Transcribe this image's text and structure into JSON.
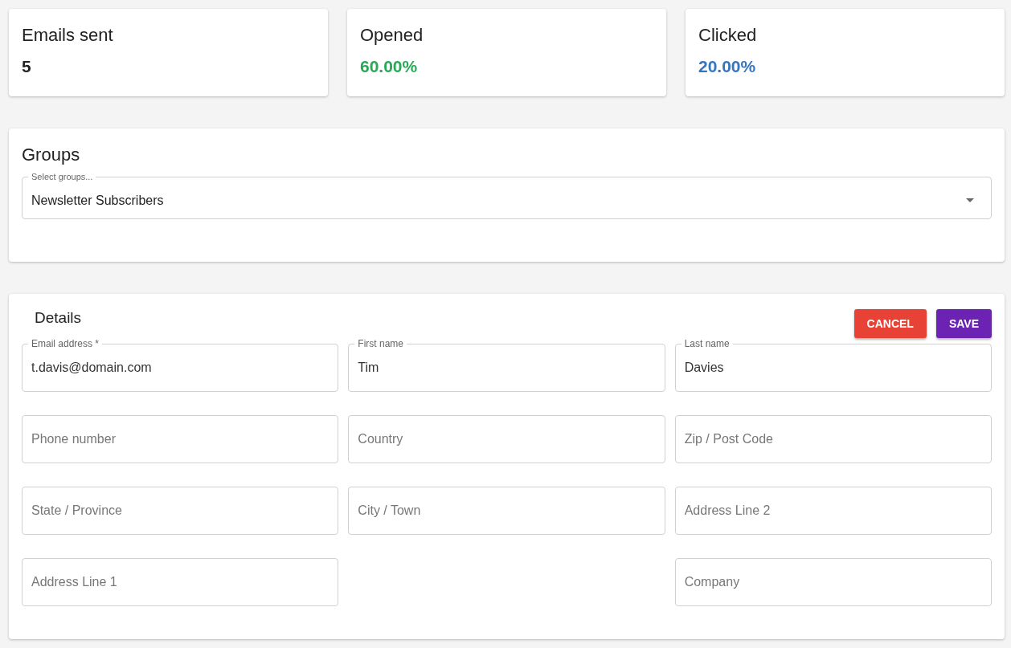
{
  "stats": [
    {
      "title": "Emails sent",
      "value": "5",
      "color": "#222222"
    },
    {
      "title": "Opened",
      "value": "60.00%",
      "color": "#27a955"
    },
    {
      "title": "Clicked",
      "value": "20.00%",
      "color": "#3576c0"
    }
  ],
  "groups": {
    "title": "Groups",
    "select": {
      "label": "Select groups...",
      "value": "Newsletter Subscribers"
    }
  },
  "details": {
    "title": "Details",
    "buttons": [
      {
        "label": "CANCEL",
        "kind": "cancel"
      },
      {
        "label": "SAVE",
        "kind": "save"
      }
    ],
    "rows": [
      [
        {
          "label": "Email address *",
          "value": "t.davis@domain.com"
        },
        {
          "label": "First name",
          "value": "Tim"
        },
        {
          "label": "Last name",
          "value": "Davies"
        }
      ],
      [
        {
          "placeholder": "Phone number"
        },
        {
          "placeholder": "Country"
        },
        {
          "placeholder": "Zip / Post Code"
        }
      ],
      [
        {
          "placeholder": "State / Province"
        },
        {
          "placeholder": "City / Town"
        },
        {
          "placeholder": "Address Line 2"
        }
      ],
      [
        {
          "placeholder": "Address Line 1"
        },
        null,
        {
          "placeholder": "Company"
        }
      ]
    ]
  }
}
